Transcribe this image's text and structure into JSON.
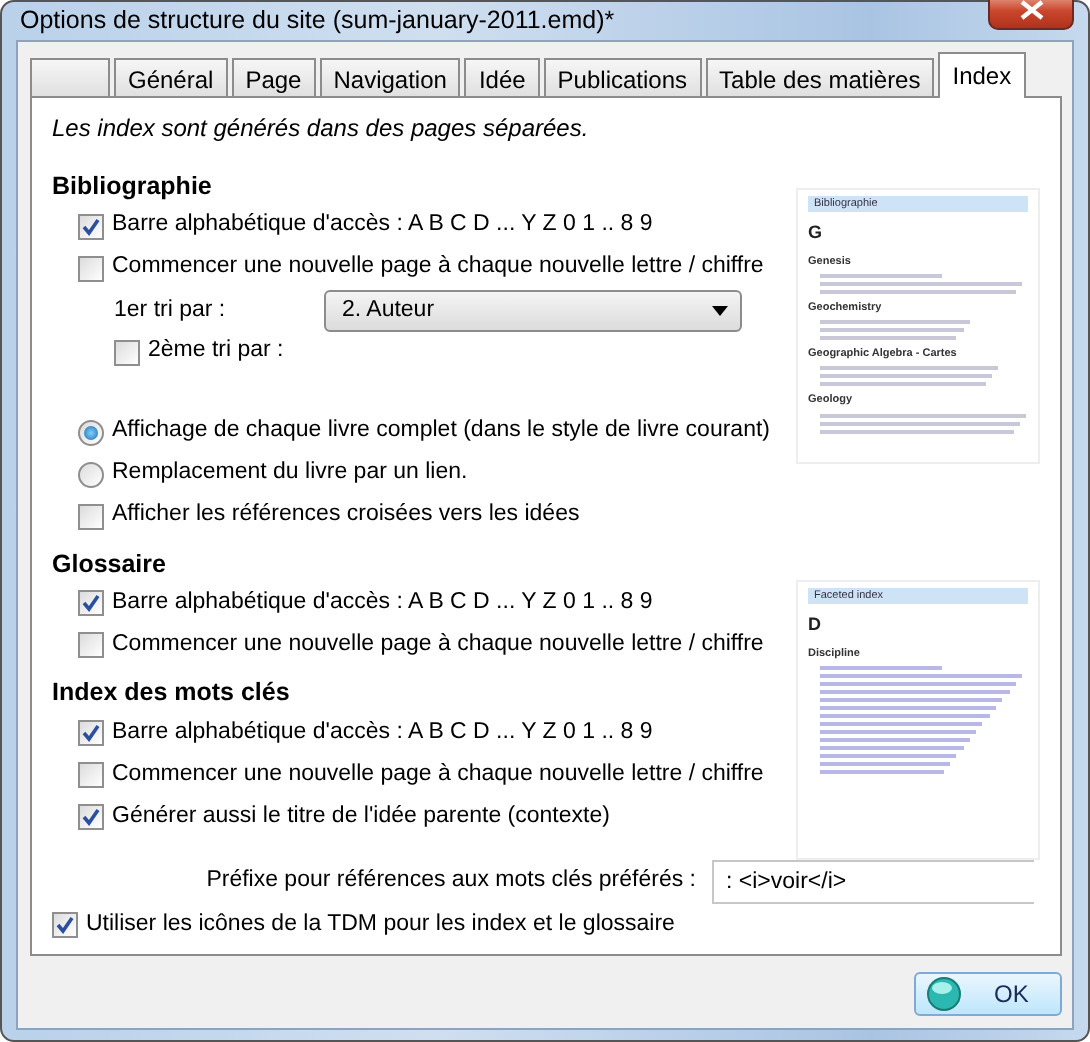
{
  "window": {
    "title": "Options de structure du site (sum-january-2011.emd)*"
  },
  "tabs": [
    {
      "kind": "blank",
      "selected": false
    },
    {
      "kind": "tab",
      "label": "Général",
      "selected": false
    },
    {
      "kind": "tab",
      "label": "Page",
      "selected": false
    },
    {
      "kind": "tab",
      "label": "Navigation",
      "selected": false
    },
    {
      "kind": "tab",
      "label": "Idée",
      "selected": false
    },
    {
      "kind": "tab",
      "label": "Publications",
      "selected": false
    },
    {
      "kind": "tab",
      "label": "Table des matières",
      "selected": false
    },
    {
      "kind": "tab",
      "label": "Index",
      "selected": true
    }
  ],
  "note": "Les index sont générés dans des pages séparées.",
  "sections": [
    {
      "title": "Bibliographie",
      "items": [
        {
          "kind": "checkbox",
          "label": "Barre alphabétique d'accès : A B C D ... Y Z 0 1 .. 8 9",
          "checked": true
        },
        {
          "kind": "checkbox",
          "label": "Commencer une nouvelle page à chaque nouvelle lettre / chiffre",
          "checked": false
        },
        {
          "kind": "select",
          "label": "1er tri par :",
          "value": "2. Auteur"
        },
        {
          "kind": "subcheckbox",
          "label": "2ème tri par :",
          "checked": false
        },
        {
          "kind": "radio",
          "label": "Affichage de chaque livre complet (dans le style de livre courant)",
          "selected": true
        },
        {
          "kind": "radio",
          "label": "Remplacement du livre par un lien.",
          "selected": false
        },
        {
          "kind": "checkbox",
          "label": "Afficher les références croisées vers les idées",
          "checked": false
        }
      ]
    },
    {
      "title": "Glossaire",
      "items": [
        {
          "kind": "checkbox",
          "label": "Barre alphabétique d'accès : A B C D ... Y Z 0 1 .. 8 9",
          "checked": true
        },
        {
          "kind": "checkbox",
          "label": "Commencer une nouvelle page à chaque nouvelle lettre / chiffre",
          "checked": false
        }
      ]
    },
    {
      "title": "Index des mots clés",
      "items": [
        {
          "kind": "checkbox",
          "label": "Barre alphabétique d'accès : A B C D ... Y Z 0 1 .. 8 9",
          "checked": true
        },
        {
          "kind": "checkbox",
          "label": "Commencer une nouvelle page à chaque nouvelle lettre / chiffre",
          "checked": false
        },
        {
          "kind": "checkbox",
          "label": "Générer aussi le titre de l'idée parente (contexte)",
          "checked": true
        }
      ]
    }
  ],
  "prefix": {
    "label": "Préfixe pour références aux mots clés préférés :",
    "value": ": <i>voir</i>"
  },
  "final_option": {
    "label": "Utiliser les icônes de la TDM pour les index et le glossaire",
    "checked": true
  },
  "previews": [
    {
      "title": "Bibliographie",
      "letter": "G",
      "headings": [
        "Genesis",
        "Geochemistry",
        "Geographic Algebra - Cartes",
        "Geology"
      ]
    },
    {
      "title": "Faceted index",
      "letter": "D",
      "headings": [
        "Discipline"
      ]
    }
  ],
  "ok_button": "OK"
}
